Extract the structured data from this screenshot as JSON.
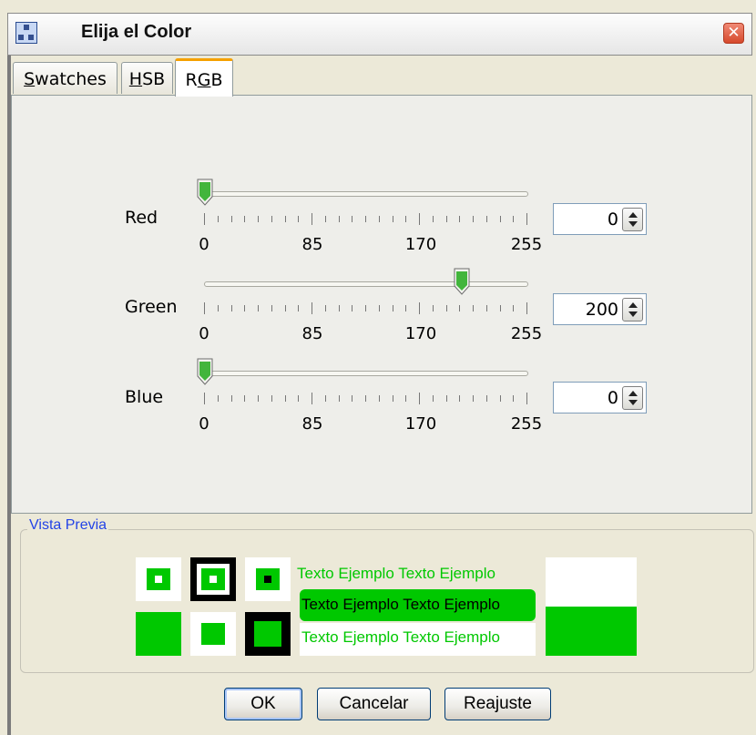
{
  "window": {
    "title": "Elija el Color"
  },
  "tabs": [
    {
      "label": "Swatches",
      "mnemonic": "S",
      "rest": "watches"
    },
    {
      "label": "HSB",
      "mnemonic": "H",
      "rest": "SB"
    },
    {
      "label": "RGB",
      "pre": "R",
      "mnemonic": "G",
      "rest": "B",
      "active": true
    }
  ],
  "sliders": {
    "tick_labels": [
      "0",
      "85",
      "170",
      "255"
    ],
    "red": {
      "label": "Red",
      "value": "0"
    },
    "green": {
      "label": "Green",
      "value": "200"
    },
    "blue": {
      "label": "Blue",
      "value": "0"
    }
  },
  "preview": {
    "legend": "Vista Previa",
    "sample_text": "Texto Ejemplo Texto Ejemplo",
    "color": "#00c800"
  },
  "buttons": {
    "ok": "OK",
    "cancel": "Cancelar",
    "reset": "Reajuste"
  }
}
